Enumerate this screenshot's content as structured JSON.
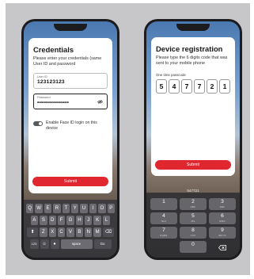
{
  "login": {
    "title": "Credentials",
    "subtitle": "Please enter your credentials (same User ID and password",
    "user_id": {
      "label": "User ID",
      "value": "123123123"
    },
    "password": {
      "label": "Password",
      "value": "••••••••••••••••"
    },
    "face_id_label": "Enable Face ID login on this device",
    "submit_label": "Submit",
    "keyboard": {
      "row1": [
        "Q",
        "W",
        "E",
        "R",
        "T",
        "Y",
        "U",
        "I",
        "O",
        "P"
      ],
      "row2": [
        "A",
        "S",
        "D",
        "F",
        "G",
        "H",
        "J",
        "K",
        "L"
      ],
      "row3": [
        "Z",
        "X",
        "C",
        "V",
        "B",
        "N",
        "M"
      ],
      "numbers_key": "123",
      "emoji_key": "☺",
      "space_key": "space",
      "go_key": "Go"
    }
  },
  "registration": {
    "title": "Device registration",
    "subtitle": "Please type the 6 digits code that was sent to your mobile phone",
    "otp_label": "One time passcode",
    "otp_digits": [
      "5",
      "4",
      "7",
      "7",
      "2",
      "1"
    ],
    "submit_label": "Submit",
    "suggestion": "547721",
    "numpad": [
      [
        {
          "d": "1",
          "l": ""
        },
        {
          "d": "2",
          "l": "ABC"
        },
        {
          "d": "3",
          "l": "DEF"
        }
      ],
      [
        {
          "d": "4",
          "l": "GHI"
        },
        {
          "d": "5",
          "l": "JKL"
        },
        {
          "d": "6",
          "l": "MNO"
        }
      ],
      [
        {
          "d": "7",
          "l": "PQRS"
        },
        {
          "d": "8",
          "l": "TUV"
        },
        {
          "d": "9",
          "l": "WXYZ"
        }
      ]
    ],
    "numpad_zero": "0"
  },
  "colors": {
    "accent": "#e0262f",
    "background": "#c7c7c9"
  }
}
